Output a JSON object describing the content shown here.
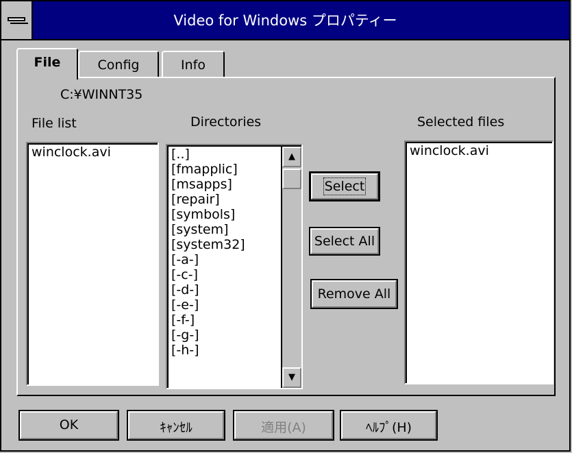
{
  "window": {
    "title": "Video for Windows プロパティー"
  },
  "tabs": [
    {
      "label": "File",
      "active": true
    },
    {
      "label": "Config",
      "active": false
    },
    {
      "label": "Info",
      "active": false
    }
  ],
  "path": "C:¥WINNT35",
  "file_list": {
    "label": "File list",
    "items": [
      "winclock.avi"
    ]
  },
  "directories": {
    "label": "Directories",
    "items": [
      "[..]",
      "[fmapplic]",
      "[msapps]",
      "[repair]",
      "[symbols]",
      "[system]",
      "[system32]",
      "[-a-]",
      "[-c-]",
      "[-d-]",
      "[-e-]",
      "[-f-]",
      "[-g-]",
      "[-h-]"
    ]
  },
  "selected_files": {
    "label": "Selected files",
    "items": [
      "winclock.avi"
    ]
  },
  "actions": {
    "select": "Select",
    "select_all": "Select All",
    "remove_all": "Remove All"
  },
  "footer": {
    "ok": "OK",
    "cancel": "ｷｬﾝｾﾙ",
    "apply": "適用(A)",
    "help": "ﾍﾙﾌﾟ(H)"
  },
  "icons": {
    "system_menu": "system-menu-icon",
    "scroll_up": "arrow-up-icon",
    "scroll_down": "arrow-down-icon"
  }
}
